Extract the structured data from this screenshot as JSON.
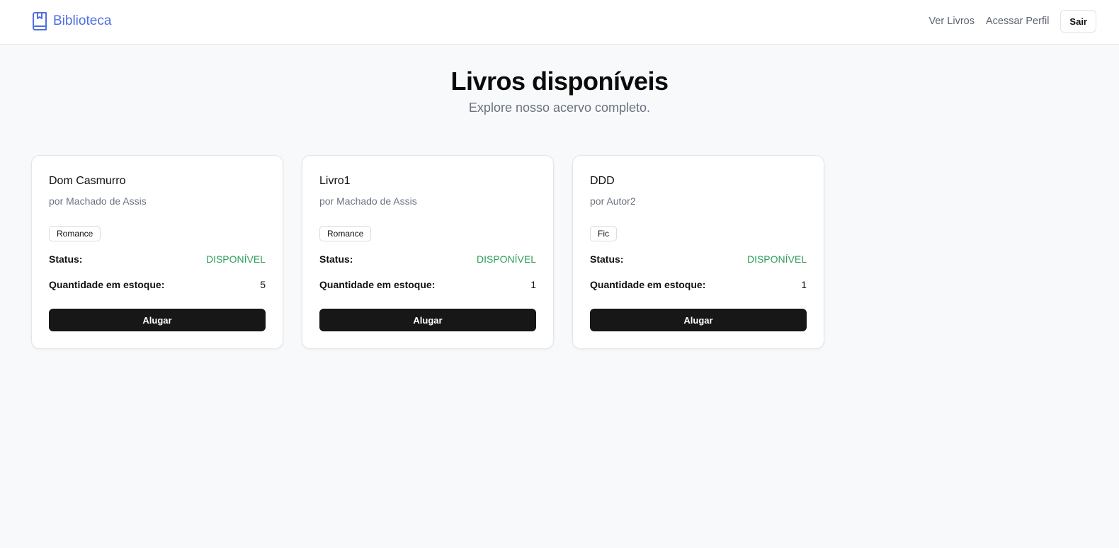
{
  "header": {
    "brand": "Biblioteca",
    "brand_icon": "book-icon",
    "brand_color": "#4f6fe0",
    "nav": {
      "books": "Ver Livros",
      "profile": "Acessar Perfil",
      "logout": "Sair"
    }
  },
  "hero": {
    "title": "Livros disponíveis",
    "subtitle": "Explore nosso acervo completo."
  },
  "labels": {
    "status": "Status:",
    "stock": "Quantidade em estoque:",
    "rent": "Alugar"
  },
  "status_color": "#2f9e5d",
  "books": [
    {
      "title": "Dom Casmurro",
      "author": "por Machado de Assis",
      "genre": "Romance",
      "status": "DISPONÍVEL",
      "stock": "5"
    },
    {
      "title": "Livro1",
      "author": "por Machado de Assis",
      "genre": "Romance",
      "status": "DISPONÍVEL",
      "stock": "1"
    },
    {
      "title": "DDD",
      "author": "por Autor2",
      "genre": "Fic",
      "status": "DISPONÍVEL",
      "stock": "1"
    }
  ]
}
